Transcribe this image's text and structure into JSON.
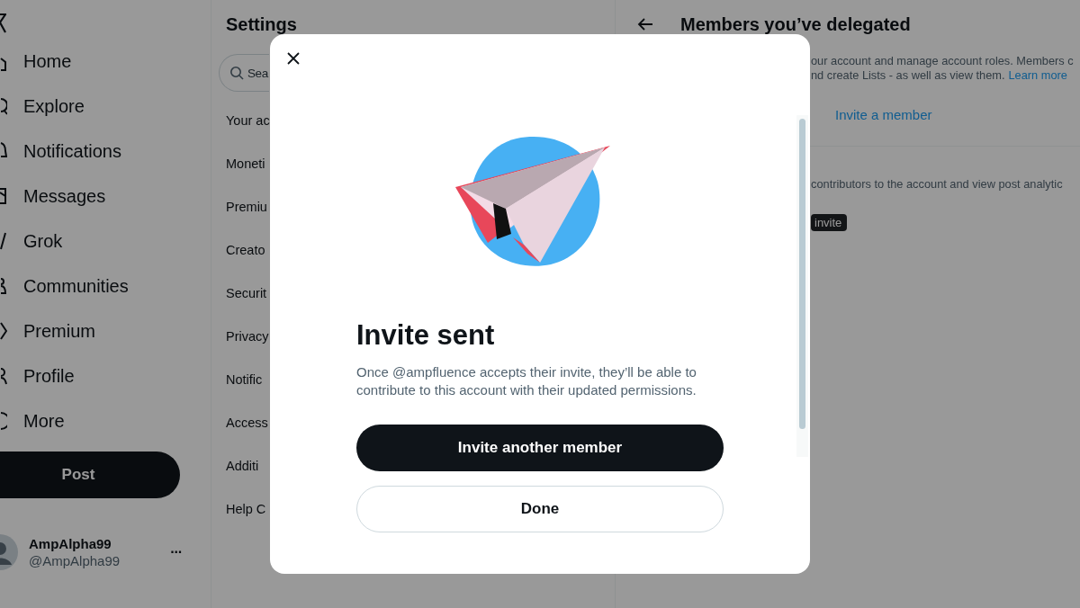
{
  "nav": {
    "items": [
      "Home",
      "Explore",
      "Notifications",
      "Messages",
      "Grok",
      "Communities",
      "Premium",
      "Profile",
      "More"
    ],
    "post_button": "Post",
    "account": {
      "name": "AmpAlpha99",
      "handle": "@AmpAlpha99",
      "menu": "···"
    }
  },
  "settings": {
    "title": "Settings",
    "search": {
      "placeholder": "Sea"
    },
    "items": [
      "Your ac",
      "Moneti",
      "Premiu",
      "Creato",
      "Securit",
      "Privacy",
      "Notific",
      "Access",
      "Additi",
      "Help C"
    ]
  },
  "members_panel": {
    "title": "Members you’ve delegated",
    "description_1": "our account and manage account roles. Members c",
    "description_2": "nd create Lists - as well as view them.",
    "learn_more": "Learn more",
    "invite_link": "Invite a member",
    "section_text": "contributors to the account and view post analytic",
    "badge": "invite"
  },
  "dialog": {
    "title": "Invite sent",
    "body": "Once @ampfluence accepts their invite, they’ll be able to contribute to this account with their updated permissions.",
    "primary_button": "Invite another member",
    "secondary_button": "Done"
  }
}
